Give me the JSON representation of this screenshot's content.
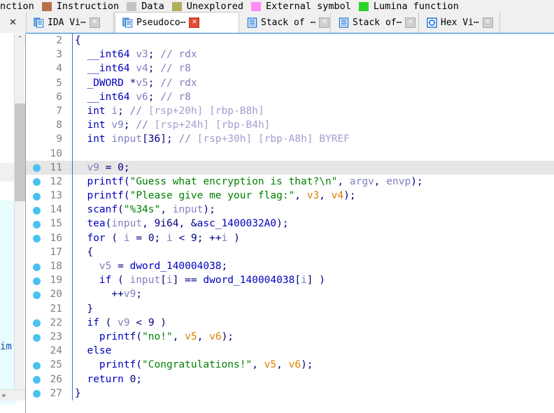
{
  "legend": {
    "items": [
      {
        "label": "nction",
        "color": "",
        "swatch": false
      },
      {
        "label": "Instruction",
        "color": "#b5714b",
        "swatch": true
      },
      {
        "label": "Data",
        "color": "#c4c4c4",
        "swatch": true
      },
      {
        "label": "Unexplored",
        "color": "#b0ad5d",
        "swatch": true
      },
      {
        "label": "External symbol",
        "color": "#ff8cf5",
        "swatch": true
      },
      {
        "label": "Lumina function",
        "color": "#2ad42a",
        "swatch": true
      }
    ]
  },
  "tabbar": {
    "close_all_glyph": "✕",
    "tabs": [
      {
        "label": "IDA Vi⋯",
        "icon": "document-blue-icon",
        "close_glyph": "✕",
        "active": false,
        "close_style": "gray"
      },
      {
        "label": "Pseudoco⋯",
        "icon": "document-blue-icon",
        "close_glyph": "✕",
        "active": true,
        "close_style": "red"
      },
      {
        "label": "Stack of ⋯",
        "icon": "stack-blue-icon",
        "close_glyph": "✕",
        "active": false,
        "close_style": "gray"
      },
      {
        "label": "Stack of⋯",
        "icon": "stack-blue-icon",
        "close_glyph": "✕",
        "active": false,
        "close_style": "gray"
      },
      {
        "label": "Hex Vi⋯",
        "icon": "hex-circle-icon",
        "close_glyph": "✕",
        "active": false,
        "close_style": "gray"
      }
    ]
  },
  "left_panel": {
    "clipped_text": "im",
    "scroll_up_glyph": "⌃",
    "scroll_down_glyph": "⌄",
    "hscroll_glyph": "»"
  },
  "pseudocode": {
    "accent_color": "#1a7fd4",
    "breakpoint_color": "#49c2f1",
    "highlight_color": "#e6e6e6",
    "lines": [
      {
        "n": "2",
        "bp": false,
        "hl": false,
        "tokens": [
          {
            "t": "{",
            "c": "brace"
          }
        ]
      },
      {
        "n": "3",
        "bp": false,
        "hl": false,
        "tokens": [
          {
            "t": "  ",
            "c": "plain"
          },
          {
            "t": "__int64",
            "c": "kw"
          },
          {
            "t": " ",
            "c": "plain"
          },
          {
            "t": "v3",
            "c": "var"
          },
          {
            "t": ";",
            "c": "pun"
          },
          {
            "t": " ",
            "c": "plain"
          },
          {
            "t": "// rdx",
            "c": "cmt"
          }
        ]
      },
      {
        "n": "4",
        "bp": false,
        "hl": false,
        "tokens": [
          {
            "t": "  ",
            "c": "plain"
          },
          {
            "t": "__int64",
            "c": "kw"
          },
          {
            "t": " ",
            "c": "plain"
          },
          {
            "t": "v4",
            "c": "var"
          },
          {
            "t": ";",
            "c": "pun"
          },
          {
            "t": " ",
            "c": "plain"
          },
          {
            "t": "// r8",
            "c": "cmt"
          }
        ]
      },
      {
        "n": "5",
        "bp": false,
        "hl": false,
        "tokens": [
          {
            "t": "  ",
            "c": "plain"
          },
          {
            "t": "_DWORD",
            "c": "kw"
          },
          {
            "t": " *",
            "c": "pun"
          },
          {
            "t": "v5",
            "c": "var"
          },
          {
            "t": ";",
            "c": "pun"
          },
          {
            "t": " ",
            "c": "plain"
          },
          {
            "t": "// rdx",
            "c": "cmt"
          }
        ]
      },
      {
        "n": "6",
        "bp": false,
        "hl": false,
        "tokens": [
          {
            "t": "  ",
            "c": "plain"
          },
          {
            "t": "__int64",
            "c": "kw"
          },
          {
            "t": " ",
            "c": "plain"
          },
          {
            "t": "v6",
            "c": "var"
          },
          {
            "t": ";",
            "c": "pun"
          },
          {
            "t": " ",
            "c": "plain"
          },
          {
            "t": "// r8",
            "c": "cmt"
          }
        ]
      },
      {
        "n": "7",
        "bp": false,
        "hl": false,
        "tokens": [
          {
            "t": "  ",
            "c": "plain"
          },
          {
            "t": "int",
            "c": "kw"
          },
          {
            "t": " ",
            "c": "plain"
          },
          {
            "t": "i",
            "c": "var"
          },
          {
            "t": ";",
            "c": "pun"
          },
          {
            "t": " ",
            "c": "plain"
          },
          {
            "t": "// ",
            "c": "cmt"
          },
          {
            "t": "[rsp+20h] [rbp-B8h]",
            "c": "var2"
          }
        ]
      },
      {
        "n": "8",
        "bp": false,
        "hl": false,
        "tokens": [
          {
            "t": "  ",
            "c": "plain"
          },
          {
            "t": "int",
            "c": "kw"
          },
          {
            "t": " ",
            "c": "plain"
          },
          {
            "t": "v9",
            "c": "var"
          },
          {
            "t": ";",
            "c": "pun"
          },
          {
            "t": " ",
            "c": "plain"
          },
          {
            "t": "// ",
            "c": "cmt"
          },
          {
            "t": "[rsp+24h] [rbp-B4h]",
            "c": "var2"
          }
        ]
      },
      {
        "n": "9",
        "bp": false,
        "hl": false,
        "tokens": [
          {
            "t": "  ",
            "c": "plain"
          },
          {
            "t": "int",
            "c": "kw"
          },
          {
            "t": " ",
            "c": "plain"
          },
          {
            "t": "input",
            "c": "var"
          },
          {
            "t": "[",
            "c": "pun"
          },
          {
            "t": "36",
            "c": "num"
          },
          {
            "t": "]",
            "c": "pun"
          },
          {
            "t": ";",
            "c": "pun"
          },
          {
            "t": " ",
            "c": "plain"
          },
          {
            "t": "// ",
            "c": "cmt"
          },
          {
            "t": "[rsp+30h] [rbp-A8h] BYREF",
            "c": "var2"
          }
        ]
      },
      {
        "n": "10",
        "bp": false,
        "hl": false,
        "tokens": []
      },
      {
        "n": "11",
        "bp": true,
        "hl": true,
        "tokens": [
          {
            "t": "  ",
            "c": "plain"
          },
          {
            "t": "v9",
            "c": "var"
          },
          {
            "t": " = ",
            "c": "pun"
          },
          {
            "t": "0",
            "c": "num"
          },
          {
            "t": ";",
            "c": "pun"
          }
        ]
      },
      {
        "n": "12",
        "bp": true,
        "hl": false,
        "tokens": [
          {
            "t": "  ",
            "c": "plain"
          },
          {
            "t": "printf",
            "c": "fn"
          },
          {
            "t": "(",
            "c": "pun"
          },
          {
            "t": "\"Guess what encryption is that?\\n\"",
            "c": "str"
          },
          {
            "t": ", ",
            "c": "pun"
          },
          {
            "t": "argv",
            "c": "var"
          },
          {
            "t": ", ",
            "c": "pun"
          },
          {
            "t": "envp",
            "c": "var"
          },
          {
            "t": ");",
            "c": "pun"
          }
        ]
      },
      {
        "n": "13",
        "bp": true,
        "hl": false,
        "tokens": [
          {
            "t": "  ",
            "c": "plain"
          },
          {
            "t": "printf",
            "c": "fn"
          },
          {
            "t": "(",
            "c": "pun"
          },
          {
            "t": "\"Please give me your flag:\"",
            "c": "str"
          },
          {
            "t": ", ",
            "c": "pun"
          },
          {
            "t": "v3",
            "c": "orange"
          },
          {
            "t": ", ",
            "c": "pun"
          },
          {
            "t": "v4",
            "c": "orange"
          },
          {
            "t": ");",
            "c": "pun"
          }
        ]
      },
      {
        "n": "14",
        "bp": true,
        "hl": false,
        "tokens": [
          {
            "t": "  ",
            "c": "plain"
          },
          {
            "t": "scanf",
            "c": "fn"
          },
          {
            "t": "(",
            "c": "pun"
          },
          {
            "t": "\"%34s\"",
            "c": "str"
          },
          {
            "t": ", ",
            "c": "pun"
          },
          {
            "t": "input",
            "c": "var"
          },
          {
            "t": ");",
            "c": "pun"
          }
        ]
      },
      {
        "n": "15",
        "bp": true,
        "hl": false,
        "tokens": [
          {
            "t": "  ",
            "c": "plain"
          },
          {
            "t": "tea",
            "c": "fn"
          },
          {
            "t": "(",
            "c": "pun"
          },
          {
            "t": "input",
            "c": "var"
          },
          {
            "t": ", ",
            "c": "pun"
          },
          {
            "t": "9i64",
            "c": "num"
          },
          {
            "t": ", &",
            "c": "pun"
          },
          {
            "t": "asc_1400032A0",
            "c": "glob"
          },
          {
            "t": ");",
            "c": "pun"
          }
        ]
      },
      {
        "n": "16",
        "bp": true,
        "hl": false,
        "tokens": [
          {
            "t": "  ",
            "c": "plain"
          },
          {
            "t": "for",
            "c": "kw"
          },
          {
            "t": " ( ",
            "c": "pun"
          },
          {
            "t": "i",
            "c": "var"
          },
          {
            "t": " = ",
            "c": "pun"
          },
          {
            "t": "0",
            "c": "num"
          },
          {
            "t": "; ",
            "c": "pun"
          },
          {
            "t": "i",
            "c": "var"
          },
          {
            "t": " < ",
            "c": "pun"
          },
          {
            "t": "9",
            "c": "num"
          },
          {
            "t": "; ++",
            "c": "pun"
          },
          {
            "t": "i",
            "c": "var"
          },
          {
            "t": " )",
            "c": "pun"
          }
        ]
      },
      {
        "n": "17",
        "bp": false,
        "hl": false,
        "tokens": [
          {
            "t": "  {",
            "c": "brace"
          }
        ]
      },
      {
        "n": "18",
        "bp": true,
        "hl": false,
        "tokens": [
          {
            "t": "    ",
            "c": "plain"
          },
          {
            "t": "v5",
            "c": "var"
          },
          {
            "t": " = ",
            "c": "pun"
          },
          {
            "t": "dword_140004038",
            "c": "glob"
          },
          {
            "t": ";",
            "c": "pun"
          }
        ]
      },
      {
        "n": "19",
        "bp": true,
        "hl": false,
        "tokens": [
          {
            "t": "    ",
            "c": "plain"
          },
          {
            "t": "if",
            "c": "kw"
          },
          {
            "t": " ( ",
            "c": "pun"
          },
          {
            "t": "input",
            "c": "var"
          },
          {
            "t": "[",
            "c": "pun"
          },
          {
            "t": "i",
            "c": "var"
          },
          {
            "t": "] == ",
            "c": "pun"
          },
          {
            "t": "dword_140004038",
            "c": "glob"
          },
          {
            "t": "[",
            "c": "pun"
          },
          {
            "t": "i",
            "c": "var"
          },
          {
            "t": "] )",
            "c": "pun"
          }
        ]
      },
      {
        "n": "20",
        "bp": true,
        "hl": false,
        "tokens": [
          {
            "t": "      ++",
            "c": "pun"
          },
          {
            "t": "v9",
            "c": "var"
          },
          {
            "t": ";",
            "c": "pun"
          }
        ]
      },
      {
        "n": "21",
        "bp": false,
        "hl": false,
        "tokens": [
          {
            "t": "  }",
            "c": "brace"
          }
        ]
      },
      {
        "n": "22",
        "bp": true,
        "hl": false,
        "tokens": [
          {
            "t": "  ",
            "c": "plain"
          },
          {
            "t": "if",
            "c": "kw"
          },
          {
            "t": " ( ",
            "c": "pun"
          },
          {
            "t": "v9",
            "c": "var"
          },
          {
            "t": " < ",
            "c": "pun"
          },
          {
            "t": "9",
            "c": "num"
          },
          {
            "t": " )",
            "c": "pun"
          }
        ]
      },
      {
        "n": "23",
        "bp": true,
        "hl": false,
        "tokens": [
          {
            "t": "    ",
            "c": "plain"
          },
          {
            "t": "printf",
            "c": "fn"
          },
          {
            "t": "(",
            "c": "pun"
          },
          {
            "t": "\"no!\"",
            "c": "str"
          },
          {
            "t": ", ",
            "c": "pun"
          },
          {
            "t": "v5",
            "c": "orange"
          },
          {
            "t": ", ",
            "c": "pun"
          },
          {
            "t": "v6",
            "c": "orange"
          },
          {
            "t": ");",
            "c": "pun"
          }
        ]
      },
      {
        "n": "24",
        "bp": false,
        "hl": false,
        "tokens": [
          {
            "t": "  ",
            "c": "plain"
          },
          {
            "t": "else",
            "c": "kw"
          }
        ]
      },
      {
        "n": "25",
        "bp": true,
        "hl": false,
        "tokens": [
          {
            "t": "    ",
            "c": "plain"
          },
          {
            "t": "printf",
            "c": "fn"
          },
          {
            "t": "(",
            "c": "pun"
          },
          {
            "t": "\"Congratulations!\"",
            "c": "str"
          },
          {
            "t": ", ",
            "c": "pun"
          },
          {
            "t": "v5",
            "c": "orange"
          },
          {
            "t": ", ",
            "c": "pun"
          },
          {
            "t": "v6",
            "c": "orange"
          },
          {
            "t": ");",
            "c": "pun"
          }
        ]
      },
      {
        "n": "26",
        "bp": true,
        "hl": false,
        "tokens": [
          {
            "t": "  ",
            "c": "plain"
          },
          {
            "t": "return",
            "c": "kw"
          },
          {
            "t": " ",
            "c": "plain"
          },
          {
            "t": "0",
            "c": "num"
          },
          {
            "t": ";",
            "c": "pun"
          }
        ]
      },
      {
        "n": "27",
        "bp": true,
        "hl": false,
        "tokens": [
          {
            "t": "}",
            "c": "brace"
          }
        ]
      }
    ]
  }
}
